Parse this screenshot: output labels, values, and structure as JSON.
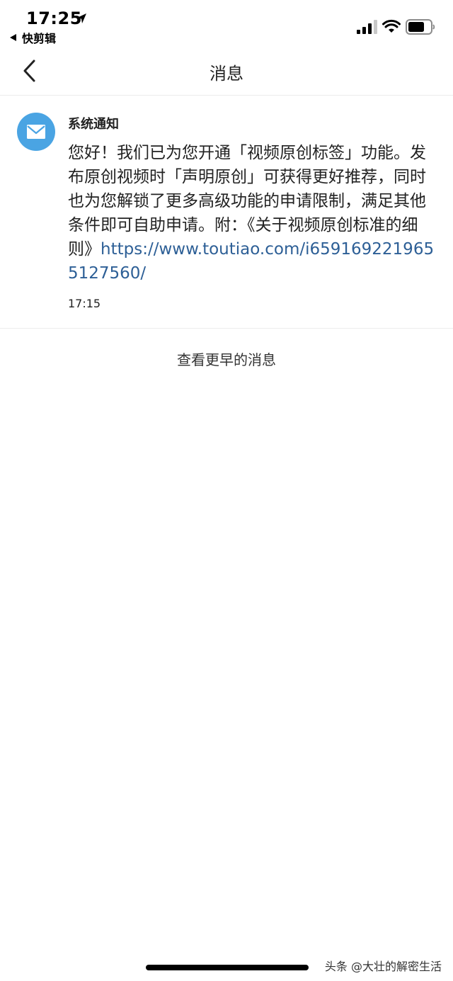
{
  "status_bar": {
    "time": "17:25",
    "back_app": "快剪辑",
    "icons": [
      "location-arrow-icon",
      "cellular-signal-icon",
      "wifi-icon",
      "battery-icon"
    ]
  },
  "nav": {
    "title": "消息",
    "back_icon": "chevron-left-icon"
  },
  "message": {
    "avatar_icon": "mail-envelope-icon",
    "avatar_color": "#4aa4e3",
    "sender": "系统通知",
    "body_text": "您好！我们已为您开通「视频原创标签」功能。发布原创视频时「声明原创」可获得更好推荐，同时也为您解锁了更多高级功能的申请限制，满足其他条件即可自助申请。附：《关于视频原创标准的细则》",
    "link_text": "https://www.toutiao.com/i6591692219655127560/",
    "link_color": "#2d5f96",
    "time": "17:15"
  },
  "earlier_messages": "查看更早的消息",
  "watermark": "头条 @大壮的解密生活"
}
